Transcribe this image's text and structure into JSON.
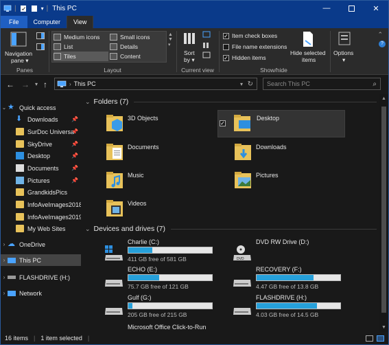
{
  "window": {
    "title": "This PC"
  },
  "tabs": [
    "File",
    "Computer",
    "View"
  ],
  "ribbon": {
    "nav_pane": {
      "label1": "Navigation",
      "label2": "pane",
      "group": "Panes"
    },
    "layout": {
      "group": "Layout",
      "items": [
        "Medium icons",
        "Small icons",
        "List",
        "Details",
        "Tiles",
        "Content"
      ]
    },
    "current_view": {
      "sort1": "Sort",
      "sort2": "by",
      "group": "Current view"
    },
    "show_hide": {
      "group": "Show/hide",
      "item_check_boxes": "Item check boxes",
      "file_name_extensions": "File name extensions",
      "hidden_items": "Hidden items",
      "hide_selected1": "Hide selected",
      "hide_selected2": "items"
    },
    "options": {
      "label": "Options"
    }
  },
  "address": {
    "path": "This PC",
    "search_placeholder": "Search This PC"
  },
  "nav": {
    "quick_access": "Quick access",
    "items": [
      "Downloads",
      "SurDoc Universa",
      "SkyDrive",
      "Desktop",
      "Documents",
      "Pictures",
      "GrandkidsPics",
      "InfoAveImages2018",
      "InfoAveImages2019",
      "My Web Sites"
    ],
    "onedrive": "OneDrive",
    "this_pc": "This PC",
    "flashdrive": "FLASHDRIVE (H:)",
    "network": "Network"
  },
  "folders": {
    "header": "Folders (7)",
    "items": [
      "3D Objects",
      "Desktop",
      "Documents",
      "Downloads",
      "Music",
      "Pictures",
      "Videos"
    ]
  },
  "drives": {
    "header": "Devices and drives (7)",
    "items": [
      {
        "name": "Charlie (C:)",
        "free": "411 GB free of 581 GB",
        "used_fraction": 0.29
      },
      {
        "name": "DVD RW Drive (D:)",
        "free": "",
        "used_fraction": null
      },
      {
        "name": "ECHO (E:)",
        "free": "75.7 GB free of 121 GB",
        "used_fraction": 0.37
      },
      {
        "name": "RECOVERY (F:)",
        "free": "4.47 GB free of 13.8 GB",
        "used_fraction": 0.68
      },
      {
        "name": "Gulf (G:)",
        "free": "205 GB free of 215 GB",
        "used_fraction": 0.05
      },
      {
        "name": "FLASHDRIVE (H:)",
        "free": "4.03 GB free of 14.5 GB",
        "used_fraction": 0.72
      },
      {
        "name": "Microsoft Office Click-to-Run",
        "free": "",
        "used_fraction": null
      }
    ]
  },
  "status": {
    "count": "16 items",
    "selected": "1 item selected"
  },
  "colors": {
    "titlebar": "#0a3a8a",
    "accent": "#26a0da",
    "folder": "#e8c25a"
  }
}
